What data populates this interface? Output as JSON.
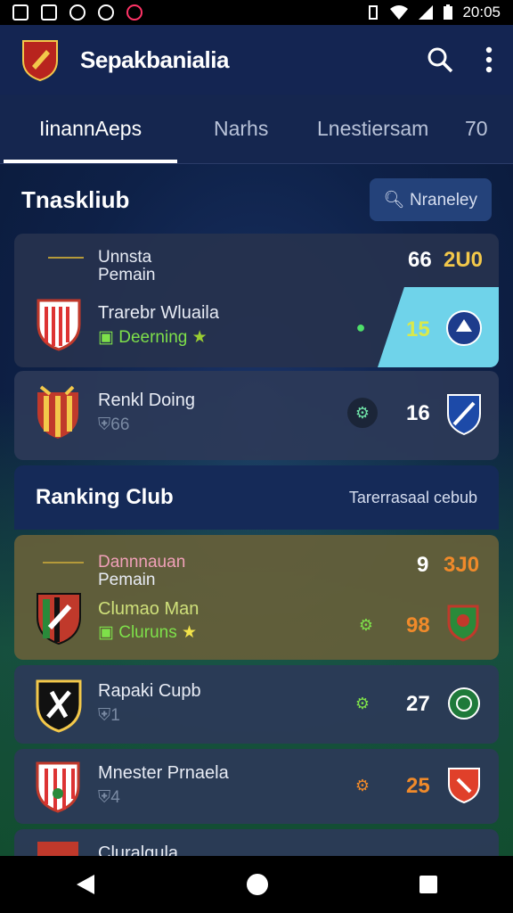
{
  "status_bar": {
    "time": "20:05"
  },
  "app": {
    "title": "Sepakbanialia"
  },
  "tabs": [
    {
      "label": "IinannAeps"
    },
    {
      "label": "Narhs"
    },
    {
      "label": "Lnestiersam"
    },
    {
      "label": "70"
    }
  ],
  "section1": {
    "title": "Tnaskliub",
    "filter_label": "Nraneley"
  },
  "card1": {
    "header_line1": "Unnsta",
    "header_line2": "Pemain",
    "score_a": "66",
    "score_b": "2U0",
    "team": "Trarebr Wluaila",
    "sub": "Deerning",
    "value": "15"
  },
  "card2": {
    "team": "Renkl Doing",
    "sub": "66",
    "value": "16"
  },
  "section2": {
    "title": "Ranking Club",
    "action": "Tarerrasaal cebub"
  },
  "card3": {
    "header_line1": "Dannnauan",
    "header_line2": "Pemain",
    "score_a": "9",
    "score_b": "3J0",
    "team": "Clumao Man",
    "sub": "Cluruns",
    "value": "98"
  },
  "card4": {
    "team": "Rapaki Cupb",
    "sub": "1",
    "value": "27"
  },
  "card5": {
    "team": "Mnester Prnaela",
    "sub": "4",
    "value": "25"
  },
  "card6": {
    "team": "Cluralgula"
  },
  "colors": {
    "accent_green": "#7ee04a",
    "score_yellow": "#f3c84a",
    "score_orange": "#f08a2a",
    "cyan_panel": "#6fd3ea"
  }
}
